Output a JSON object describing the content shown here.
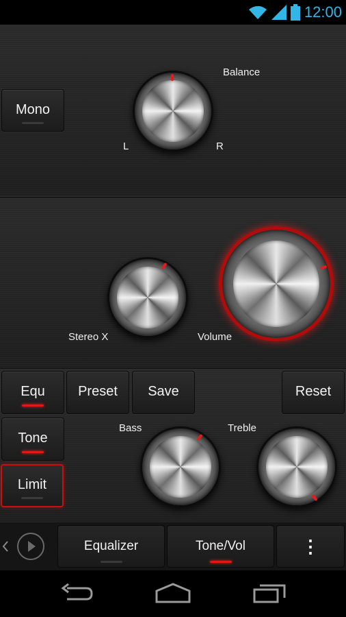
{
  "status": {
    "time": "12:00",
    "icons": [
      "wifi-icon",
      "signal-icon",
      "battery-icon"
    ]
  },
  "balance": {
    "title": "Balance",
    "left": "L",
    "right": "R"
  },
  "mono": {
    "label": "Mono"
  },
  "stereo": {
    "label": "Stereo X"
  },
  "volume": {
    "label": "Volume"
  },
  "buttons": {
    "equ": "Equ",
    "preset": "Preset",
    "save": "Save",
    "reset": "Reset",
    "tone": "Tone",
    "limit": "Limit"
  },
  "tone": {
    "bass": "Bass",
    "treble": "Treble"
  },
  "tabs": {
    "equalizer": "Equalizer",
    "tonevol": "Tone/Vol",
    "more": "⋮"
  },
  "colors": {
    "accent": "#e01818",
    "clock": "#33b5e5"
  }
}
